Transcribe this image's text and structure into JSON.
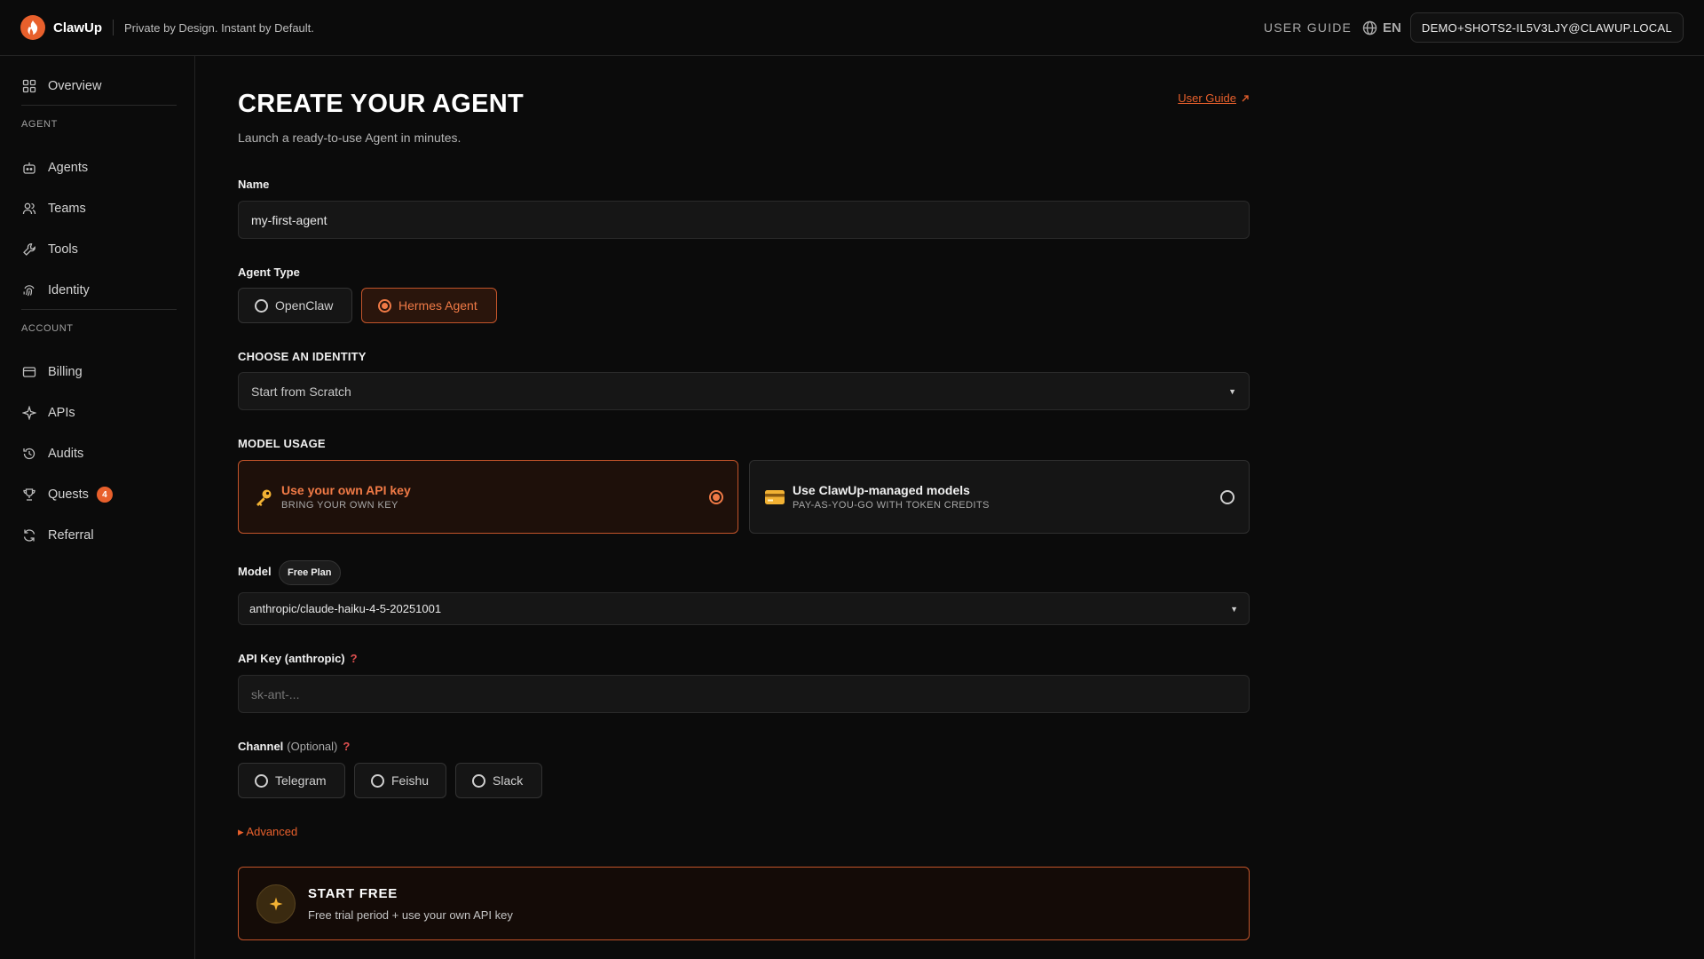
{
  "header": {
    "brand": "ClawUp",
    "tagline": "Private by Design. Instant by Default.",
    "user_guide": "USER GUIDE",
    "language": "EN",
    "account_email": "DEMO+SHOTS2-IL5V3LJY@CLAWUP.LOCAL"
  },
  "sidebar": {
    "overview": "Overview",
    "section_agent": "AGENT",
    "agents": "Agents",
    "teams": "Teams",
    "tools": "Tools",
    "identity": "Identity",
    "section_account": "ACCOUNT",
    "billing": "Billing",
    "apis": "APIs",
    "audits": "Audits",
    "quests": "Quests",
    "quests_badge": "4",
    "referral": "Referral"
  },
  "main": {
    "title": "CREATE YOUR AGENT",
    "subtitle": "Launch a ready-to-use Agent in minutes.",
    "user_guide_link": "User Guide",
    "name_label": "Name",
    "name_value": "my-first-agent",
    "agent_type_label": "Agent Type",
    "agent_types": [
      "OpenClaw",
      "Hermes Agent"
    ],
    "agent_type_selected": "Hermes Agent",
    "identity_label": "CHOOSE AN IDENTITY",
    "identity_value": "Start from Scratch",
    "model_usage_label": "MODEL USAGE",
    "usage_own_title": "Use your own API key",
    "usage_own_sub": "BRING YOUR OWN KEY",
    "usage_managed_title": "Use ClawUp-managed models",
    "usage_managed_sub": "PAY-AS-YOU-GO WITH TOKEN CREDITS",
    "model_label": "Model",
    "plan_badge": "Free Plan",
    "model_value": "anthropic/claude-haiku-4-5-20251001",
    "api_key_label": "API Key (anthropic)",
    "api_key_placeholder": "sk-ant-...",
    "channel_label": "Channel",
    "channel_optional": "(Optional)",
    "channels": [
      "Telegram",
      "Feishu",
      "Slack"
    ],
    "advanced": "▸ Advanced",
    "start_title": "START FREE",
    "start_sub": "Free trial period + use your own API key"
  },
  "colors": {
    "accent": "#e8602c",
    "background": "#0b0b0b",
    "panel": "#161616"
  }
}
